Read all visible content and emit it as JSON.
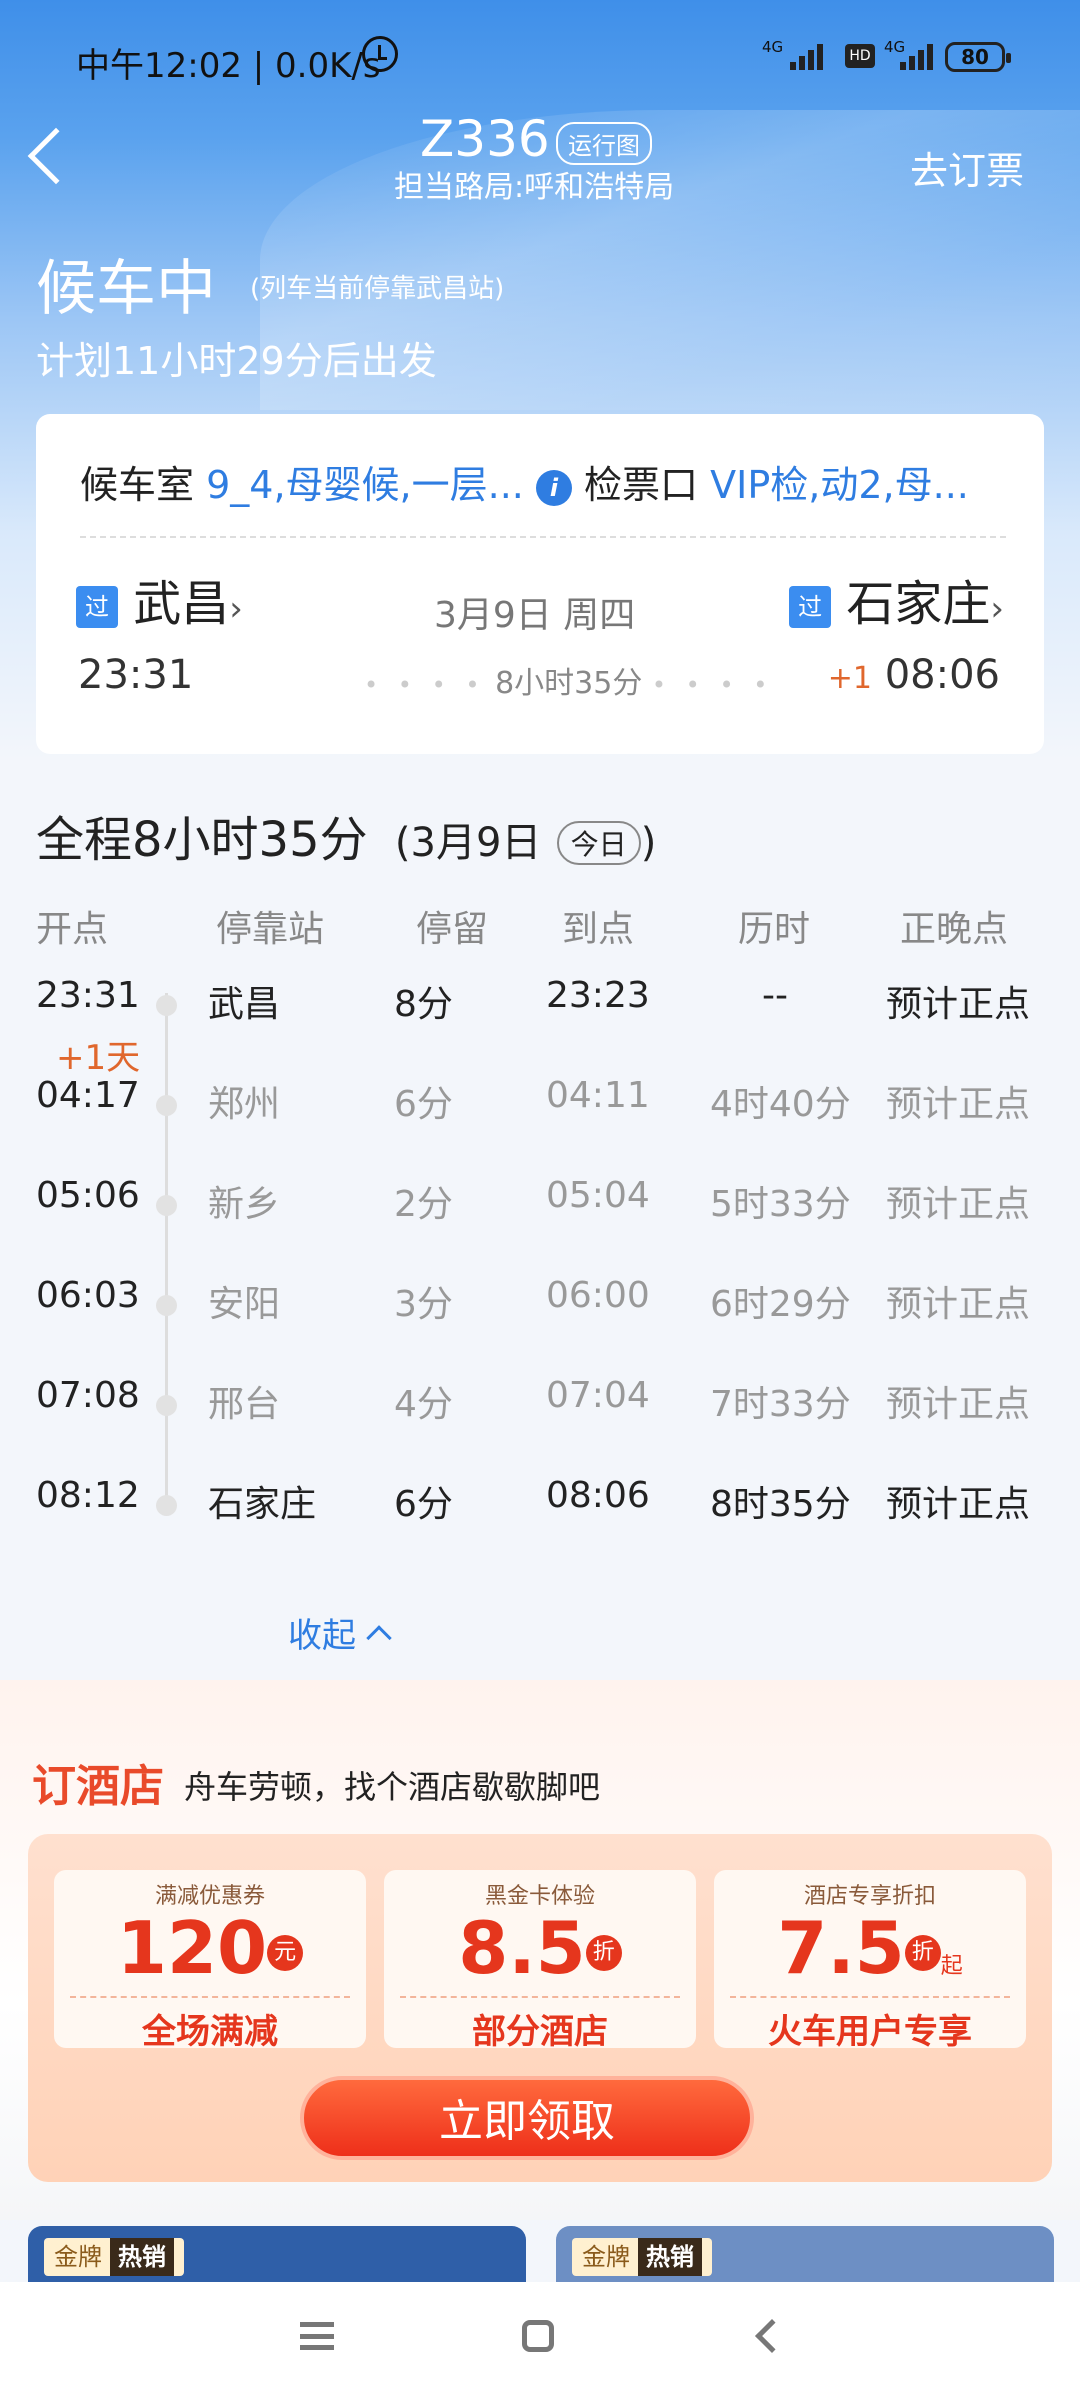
{
  "status_bar": {
    "time": "中午12:02 | 0.0K/s",
    "sim1": "4G",
    "hd": "HD",
    "sim2": "4G",
    "battery": "80"
  },
  "header": {
    "train_no": "Z336",
    "run_chart": "运行图",
    "bureau": "担当路局:呼和浩特局",
    "book": "去订票"
  },
  "status": {
    "state": "候车中",
    "note": "(列车当前停靠武昌站)",
    "departure": "计划11小时29分后出发"
  },
  "card": {
    "waiting_label": "候车室",
    "waiting_value": "9_4,母婴候,一层...",
    "gate_label": "检票口",
    "gate_value": "VIP检,动2,母...",
    "pass_badge": "过",
    "from": "武昌",
    "to": "石家庄",
    "date": "3月9日 周四",
    "depart_time": "23:31",
    "duration": "8小时35分",
    "plus_day": "+1",
    "arrive_time": "08:06"
  },
  "summary": {
    "total": "全程8小时35分",
    "date": "(3月9日",
    "today": "今日",
    "close": ")"
  },
  "table": {
    "headers": [
      "开点",
      "停靠站",
      "停留",
      "到点",
      "历时",
      "正晚点"
    ],
    "day_tag": "+1天",
    "rows": [
      {
        "dep": "23:31",
        "station": "武昌",
        "stop": "8分",
        "arr": "23:23",
        "elapsed": "--",
        "status": "预计正点"
      },
      {
        "dep": "04:17",
        "station": "郑州",
        "stop": "6分",
        "arr": "04:11",
        "elapsed": "4时40分",
        "status": "预计正点"
      },
      {
        "dep": "05:06",
        "station": "新乡",
        "stop": "2分",
        "arr": "05:04",
        "elapsed": "5时33分",
        "status": "预计正点"
      },
      {
        "dep": "06:03",
        "station": "安阳",
        "stop": "3分",
        "arr": "06:00",
        "elapsed": "6时29分",
        "status": "预计正点"
      },
      {
        "dep": "07:08",
        "station": "邢台",
        "stop": "4分",
        "arr": "07:04",
        "elapsed": "7时33分",
        "status": "预计正点"
      },
      {
        "dep": "08:12",
        "station": "石家庄",
        "stop": "6分",
        "arr": "08:06",
        "elapsed": "8时35分",
        "status": "预计正点"
      }
    ],
    "collapse": "收起"
  },
  "hotel": {
    "title": "订酒店",
    "subtitle": "舟车劳顿，找个酒店歇歇脚吧",
    "coupons": [
      {
        "top": "满减优惠券",
        "value": "120",
        "unit": "元",
        "extra": "",
        "bottom": "全场满减"
      },
      {
        "top": "黑金卡体验",
        "value": "8.5",
        "unit": "折",
        "extra": "",
        "bottom": "部分酒店"
      },
      {
        "top": "酒店专享折扣",
        "value": "7.5",
        "unit": "折",
        "extra": "起",
        "bottom": "火车用户专享"
      }
    ],
    "claim": "立即领取"
  },
  "products": [
    {
      "tag": "金牌",
      "hot": "热销"
    },
    {
      "tag": "金牌",
      "hot": "热销"
    }
  ],
  "colors": {
    "accent": "#2f7de1",
    "late": "#e0672d",
    "promo_red": "#e5361d"
  }
}
